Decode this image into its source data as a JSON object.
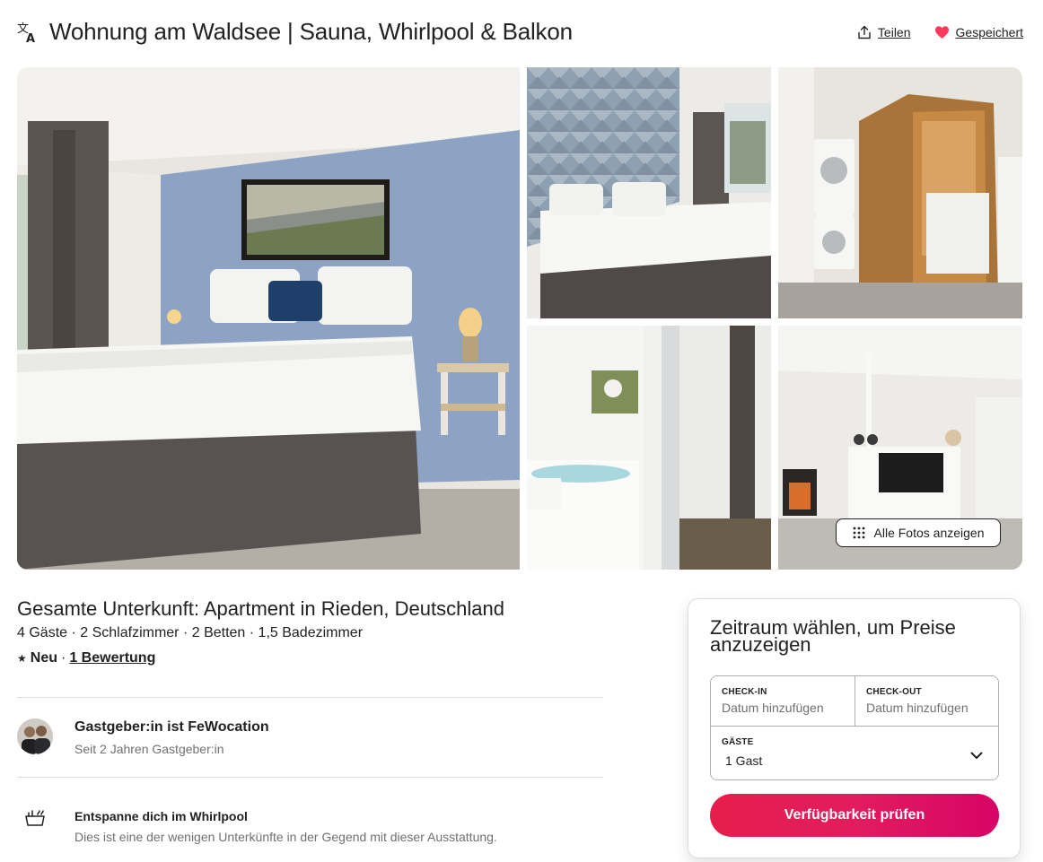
{
  "header": {
    "title": "Wohnung am Waldsee | Sauna, Whirlpool & Balkon",
    "translate_icon": "translate-icon",
    "share_label": "Teilen",
    "share_icon": "share-icon",
    "saved_label": "Gespeichert",
    "saved_icon": "heart-icon",
    "saved_color": "#ff385c"
  },
  "gallery": {
    "photos": [
      {
        "subject": "bedroom with double bed"
      },
      {
        "subject": "second bedroom"
      },
      {
        "subject": "infrared sauna and washing machine"
      },
      {
        "subject": "bathroom with whirlpool and shower"
      },
      {
        "subject": "living room with fireplace and kitchen"
      }
    ],
    "show_all_label": "Alle Fotos anzeigen",
    "show_all_icon": "grid-dots-icon"
  },
  "listing": {
    "title": "Gesamte Unterkunft: Apartment in Rieden, Deutschland",
    "details": "4 Gäste · 2 Schlafzimmer · 2 Betten · 1,5 Badezimmer",
    "rating_prefix": "★",
    "rating_new": "Neu",
    "separator": "·",
    "reviews_link": "1 Bewertung"
  },
  "host": {
    "name": "Gastgeber:in ist FeWocation",
    "since": "Seit 2 Jahren Gastgeber:in"
  },
  "features": [
    {
      "icon": "whirlpool-icon",
      "title": "Entspanne dich im Whirlpool",
      "description": "Dies ist eine der wenigen Unterkünfte in der Gegend mit dieser Ausstattung."
    }
  ],
  "booking": {
    "title": "Zeitraum wählen, um Preise anzuzeigen",
    "checkin_label": "CHECK-IN",
    "checkin_value": "Datum hinzufügen",
    "checkout_label": "CHECK-OUT",
    "checkout_value": "Datum hinzufügen",
    "guests_label": "GÄSTE",
    "guests_value": "1 Gast",
    "cta_label": "Verfügbarkeit prüfen",
    "cta_color": "#e31c5f"
  }
}
